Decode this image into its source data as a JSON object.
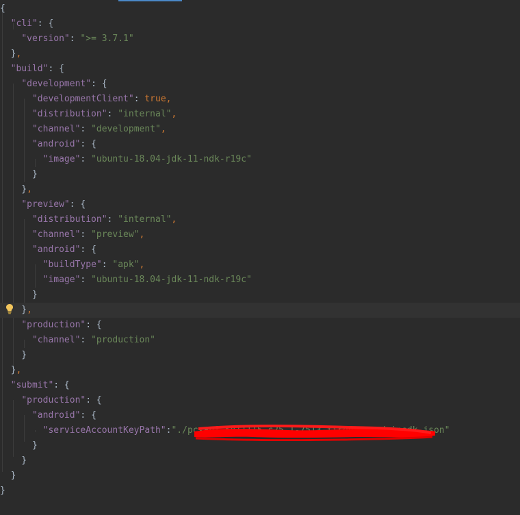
{
  "code": {
    "lines": [
      {
        "parts": [
          {
            "t": "{",
            "c": "p"
          }
        ]
      },
      {
        "parts": [
          {
            "t": "  ",
            "c": "p"
          },
          {
            "t": "\"cli\"",
            "c": "k"
          },
          {
            "t": ": {",
            "c": "p"
          }
        ]
      },
      {
        "parts": [
          {
            "t": "    ",
            "c": "p"
          },
          {
            "t": "\"version\"",
            "c": "k"
          },
          {
            "t": ": ",
            "c": "p"
          },
          {
            "t": "\">= 3.7.1\"",
            "c": "s"
          }
        ]
      },
      {
        "parts": [
          {
            "t": "  }",
            "c": "p"
          },
          {
            "t": ",",
            "c": "b"
          }
        ]
      },
      {
        "parts": [
          {
            "t": "  ",
            "c": "p"
          },
          {
            "t": "\"build\"",
            "c": "k"
          },
          {
            "t": ": {",
            "c": "p"
          }
        ]
      },
      {
        "parts": [
          {
            "t": "    ",
            "c": "p"
          },
          {
            "t": "\"development\"",
            "c": "k"
          },
          {
            "t": ": {",
            "c": "p"
          }
        ]
      },
      {
        "parts": [
          {
            "t": "      ",
            "c": "p"
          },
          {
            "t": "\"developmentClient\"",
            "c": "k"
          },
          {
            "t": ": ",
            "c": "p"
          },
          {
            "t": "true",
            "c": "b"
          },
          {
            "t": ",",
            "c": "b"
          }
        ]
      },
      {
        "parts": [
          {
            "t": "      ",
            "c": "p"
          },
          {
            "t": "\"distribution\"",
            "c": "k"
          },
          {
            "t": ": ",
            "c": "p"
          },
          {
            "t": "\"internal\"",
            "c": "s"
          },
          {
            "t": ",",
            "c": "b"
          }
        ]
      },
      {
        "parts": [
          {
            "t": "      ",
            "c": "p"
          },
          {
            "t": "\"channel\"",
            "c": "k"
          },
          {
            "t": ": ",
            "c": "p"
          },
          {
            "t": "\"development\"",
            "c": "s"
          },
          {
            "t": ",",
            "c": "b"
          }
        ]
      },
      {
        "parts": [
          {
            "t": "      ",
            "c": "p"
          },
          {
            "t": "\"android\"",
            "c": "k"
          },
          {
            "t": ": {",
            "c": "p"
          }
        ]
      },
      {
        "parts": [
          {
            "t": "        ",
            "c": "p"
          },
          {
            "t": "\"image\"",
            "c": "k"
          },
          {
            "t": ": ",
            "c": "p"
          },
          {
            "t": "\"ubuntu-18.04-jdk-11-ndk-r19c\"",
            "c": "s"
          }
        ]
      },
      {
        "parts": [
          {
            "t": "      }",
            "c": "p"
          }
        ]
      },
      {
        "parts": [
          {
            "t": "    }",
            "c": "p"
          },
          {
            "t": ",",
            "c": "b"
          }
        ]
      },
      {
        "parts": [
          {
            "t": "    ",
            "c": "p"
          },
          {
            "t": "\"preview\"",
            "c": "k"
          },
          {
            "t": ": {",
            "c": "p"
          }
        ]
      },
      {
        "parts": [
          {
            "t": "      ",
            "c": "p"
          },
          {
            "t": "\"distribution\"",
            "c": "k"
          },
          {
            "t": ": ",
            "c": "p"
          },
          {
            "t": "\"internal\"",
            "c": "s"
          },
          {
            "t": ",",
            "c": "b"
          }
        ]
      },
      {
        "parts": [
          {
            "t": "      ",
            "c": "p"
          },
          {
            "t": "\"channel\"",
            "c": "k"
          },
          {
            "t": ": ",
            "c": "p"
          },
          {
            "t": "\"preview\"",
            "c": "s"
          },
          {
            "t": ",",
            "c": "b"
          }
        ]
      },
      {
        "parts": [
          {
            "t": "      ",
            "c": "p"
          },
          {
            "t": "\"android\"",
            "c": "k"
          },
          {
            "t": ": {",
            "c": "p"
          }
        ]
      },
      {
        "parts": [
          {
            "t": "        ",
            "c": "p"
          },
          {
            "t": "\"buildType\"",
            "c": "k"
          },
          {
            "t": ": ",
            "c": "p"
          },
          {
            "t": "\"apk\"",
            "c": "s"
          },
          {
            "t": ",",
            "c": "b"
          }
        ]
      },
      {
        "parts": [
          {
            "t": "        ",
            "c": "p"
          },
          {
            "t": "\"image\"",
            "c": "k"
          },
          {
            "t": ": ",
            "c": "p"
          },
          {
            "t": "\"ubuntu-18.04-jdk-11-ndk-r19c\"",
            "c": "s"
          }
        ]
      },
      {
        "parts": [
          {
            "t": "      }",
            "c": "p"
          }
        ]
      },
      {
        "parts": [
          {
            "t": "    }",
            "c": "p"
          },
          {
            "t": ",",
            "c": "b"
          }
        ]
      },
      {
        "parts": [
          {
            "t": "    ",
            "c": "p"
          },
          {
            "t": "\"production\"",
            "c": "k"
          },
          {
            "t": ": {",
            "c": "p"
          }
        ]
      },
      {
        "parts": [
          {
            "t": "      ",
            "c": "p"
          },
          {
            "t": "\"channel\"",
            "c": "k"
          },
          {
            "t": ": ",
            "c": "p"
          },
          {
            "t": "\"production\"",
            "c": "s"
          }
        ]
      },
      {
        "parts": [
          {
            "t": "    }",
            "c": "p"
          }
        ]
      },
      {
        "parts": [
          {
            "t": "  }",
            "c": "p"
          },
          {
            "t": ",",
            "c": "b"
          }
        ]
      },
      {
        "parts": [
          {
            "t": "  ",
            "c": "p"
          },
          {
            "t": "\"submit\"",
            "c": "k"
          },
          {
            "t": ": {",
            "c": "p"
          }
        ]
      },
      {
        "parts": [
          {
            "t": "    ",
            "c": "p"
          },
          {
            "t": "\"production\"",
            "c": "k"
          },
          {
            "t": ": {",
            "c": "p"
          }
        ]
      },
      {
        "parts": [
          {
            "t": "      ",
            "c": "p"
          },
          {
            "t": "\"android\"",
            "c": "k"
          },
          {
            "t": ": {",
            "c": "p"
          }
        ]
      },
      {
        "parts": [
          {
            "t": "        ",
            "c": "p"
          },
          {
            "t": "\"serviceAccountKeyPath\"",
            "c": "k"
          },
          {
            "t": ":",
            "c": "p"
          },
          {
            "t": "\"./pc-api-5811115-c25-1-7513-firebase-adminsdk.json\"",
            "c": "s"
          }
        ]
      },
      {
        "parts": [
          {
            "t": "      }",
            "c": "p"
          }
        ]
      },
      {
        "parts": [
          {
            "t": "    }",
            "c": "p"
          }
        ]
      },
      {
        "parts": [
          {
            "t": "  }",
            "c": "p"
          }
        ]
      },
      {
        "parts": [
          {
            "t": "}",
            "c": "p"
          }
        ]
      }
    ]
  },
  "current_line": 20,
  "colors": {
    "background": "#2b2b2b",
    "current_line": "#323232",
    "key": "#9876aa",
    "string": "#6a8759",
    "keyword": "#cc7832",
    "punctuation": "#a9b7c6",
    "redaction": "#ff0000"
  },
  "icons": {
    "gutter": "lightbulb-icon"
  }
}
